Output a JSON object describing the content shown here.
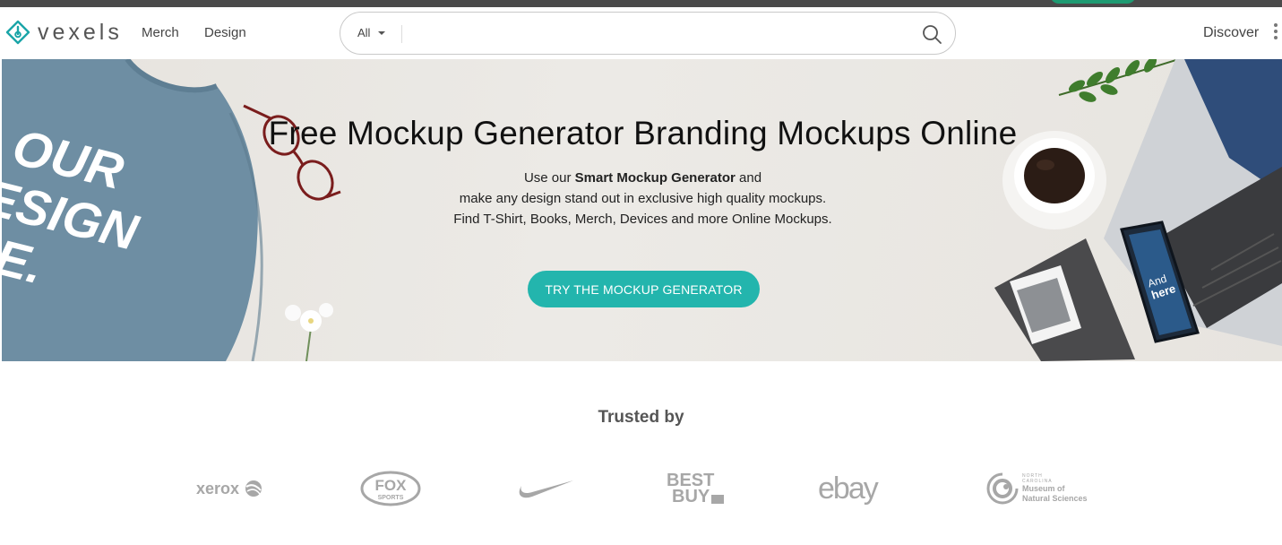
{
  "header": {
    "logo_text": "vexels",
    "nav": {
      "merch": "Merch",
      "design": "Design"
    },
    "search": {
      "scope": "All",
      "placeholder": ""
    },
    "discover": "Discover"
  },
  "hero": {
    "title": "Free Mockup Generator Branding Mockups Online",
    "subtitle_prefix": "Use our ",
    "subtitle_bold": "Smart Mockup Generator",
    "subtitle_suffix": " and",
    "line2": "make any design stand out in exclusive high quality mockups.",
    "line3": "Find T-Shirt, Books, Merch, Devices and more Online Mockups.",
    "cta_label": "TRY THE MOCKUP GENERATOR",
    "sweater_print": [
      "OUR",
      "ESIGN",
      "RE."
    ],
    "phone_print": [
      "And",
      "here"
    ]
  },
  "trusted": {
    "heading": "Trusted by",
    "brands": {
      "xerox": "xerox",
      "fox_top": "FOX",
      "fox_bottom": "SPORTS",
      "nike": "nike",
      "bestbuy_top": "BEST",
      "bestbuy_bottom": "BUY",
      "ebay": "ebay",
      "museum_small1": "NORTH",
      "museum_small2": "CAROLINA",
      "museum_line1": "Museum of",
      "museum_line2": "Natural Sciences"
    }
  },
  "colors": {
    "brand_teal": "#23b5ad",
    "logo_teal": "#1aa5a8",
    "sweater": "#6e8ea3",
    "brand_gray": "#a7a7a7"
  }
}
